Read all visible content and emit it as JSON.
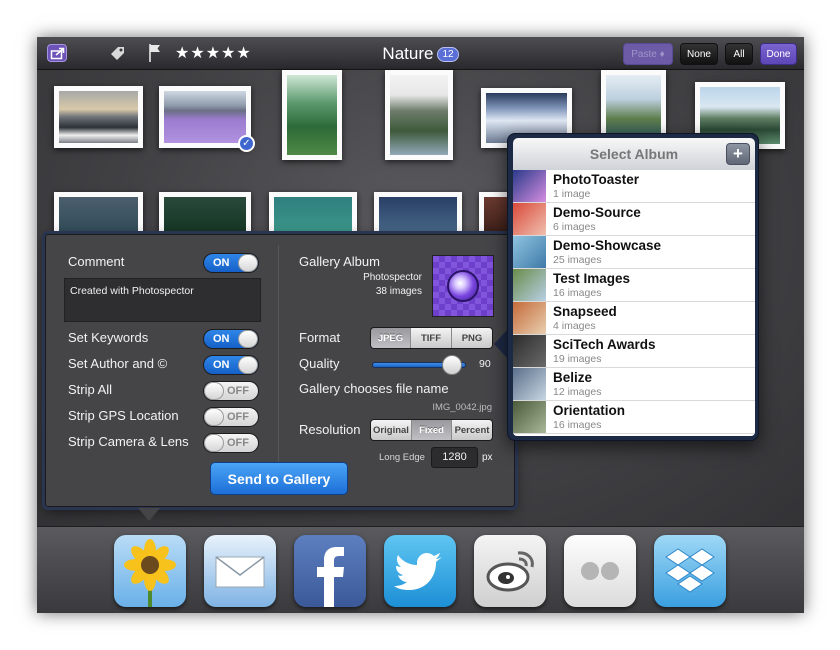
{
  "toolbar": {
    "title": "Nature",
    "count": "12",
    "stars": [
      "★",
      "★",
      "★",
      "★",
      "★"
    ],
    "paste_label": "Paste ♦",
    "none_label": "None",
    "all_label": "All",
    "done_label": "Done",
    "icons": [
      "share-icon",
      "tag-icon",
      "flag-icon",
      "star-icon"
    ]
  },
  "panel": {
    "comment_label": "Comment",
    "comment_toggle": "ON",
    "comment_text": "Created with Photospector",
    "set_keywords_label": "Set Keywords",
    "set_keywords_toggle": "ON",
    "set_author_label": "Set Author and ©",
    "set_author_toggle": "ON",
    "strip_all_label": "Strip All",
    "strip_all_toggle": "OFF",
    "strip_gps_label": "Strip GPS Location",
    "strip_gps_toggle": "OFF",
    "strip_camera_label": "Strip Camera & Lens",
    "strip_camera_toggle": "OFF",
    "gallery_album_label": "Gallery Album",
    "gallery_album_name": "Photospector",
    "gallery_album_count": "38 images",
    "format_label": "Format",
    "format_options": [
      "JPEG",
      "TIFF",
      "PNG"
    ],
    "format_selected": "JPEG",
    "quality_label": "Quality",
    "quality_value": "90",
    "gallery_filename_label": "Gallery chooses file name",
    "filename": "IMG_0042.jpg",
    "resolution_label": "Resolution",
    "resolution_options": [
      "Original",
      "Fixed",
      "Percent"
    ],
    "resolution_selected": "Fixed",
    "long_edge_label": "Long Edge",
    "long_edge_value": "1280",
    "long_edge_unit": "px",
    "send_button": "Send to Gallery"
  },
  "popover": {
    "title": "Select Album",
    "add_label": "+",
    "albums": [
      {
        "name": "PhotoToaster",
        "count": "1 image"
      },
      {
        "name": "Demo-Source",
        "count": "6 images"
      },
      {
        "name": "Demo-Showcase",
        "count": "25 images"
      },
      {
        "name": "Test Images",
        "count": "16 images"
      },
      {
        "name": "Snapseed",
        "count": "4 images"
      },
      {
        "name": "SciTech Awards",
        "count": "19 images"
      },
      {
        "name": "Belize",
        "count": "12 images"
      },
      {
        "name": "Orientation",
        "count": "16 images"
      }
    ]
  },
  "dock": {
    "apps": [
      "photos-app-icon",
      "mail-app-icon",
      "facebook-app-icon",
      "twitter-app-icon",
      "weibo-app-icon",
      "flickr-app-icon",
      "dropbox-app-icon"
    ]
  },
  "colors": {
    "accent_purple": "#6d52b8",
    "toggle_on": "#1f73dc",
    "send_button": "#2a85e6"
  }
}
